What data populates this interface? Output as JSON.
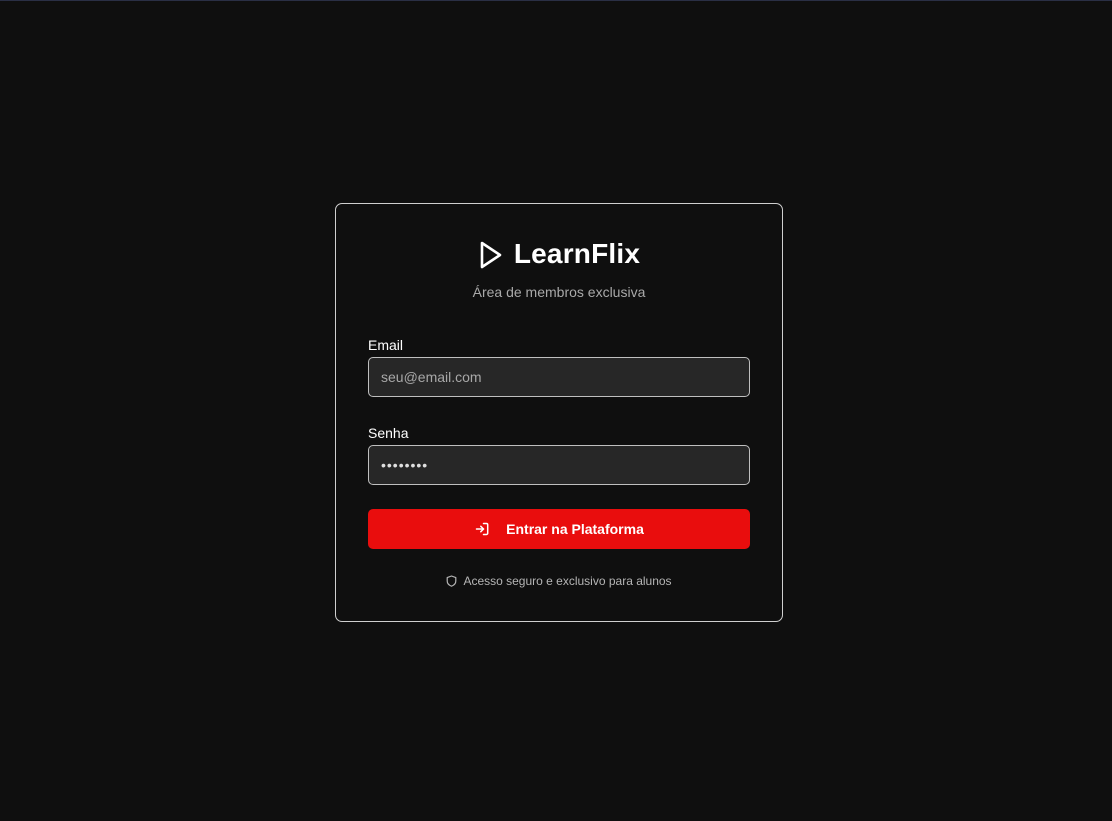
{
  "brand": {
    "title": "LearnFlix",
    "icon": "play-icon",
    "subtitle": "Área de membros exclusiva"
  },
  "form": {
    "email": {
      "label": "Email",
      "placeholder": "seu@email.com",
      "value": ""
    },
    "password": {
      "label": "Senha",
      "value": "••••••••"
    },
    "submit": {
      "label": "Entrar na Plataforma",
      "icon": "log-in-icon"
    }
  },
  "footer": {
    "note": "Acesso seguro e exclusivo para alunos",
    "icon": "shield-icon"
  },
  "colors": {
    "background": "#0f0f0f",
    "accent": "#e90d0d",
    "input_bg": "#272727",
    "border": "#cfcfcf"
  }
}
